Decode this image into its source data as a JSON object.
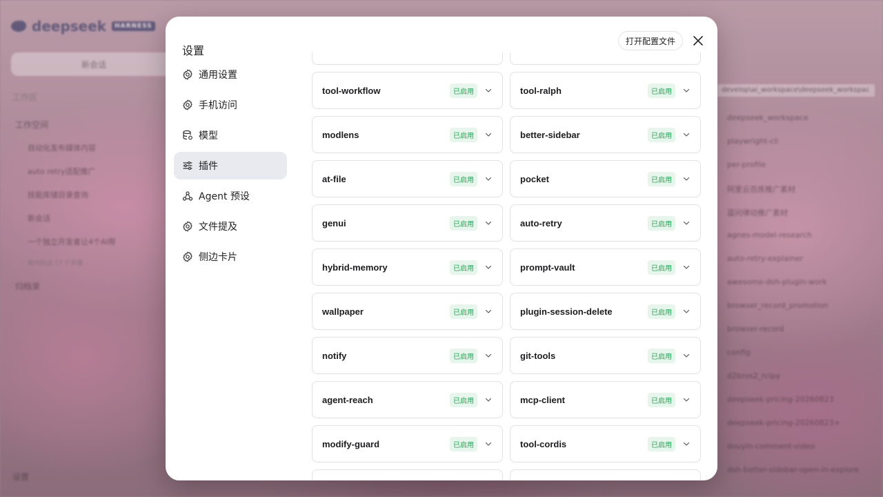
{
  "background_app": {
    "logo_text": "deepseek",
    "logo_badge": "HARNESS",
    "new_chat_label": "新会话",
    "section_label": "工作区",
    "workspace_label": "工作空间",
    "sessions": [
      "自动化发布媒体内容",
      "auto retry适配推广",
      "技能库储目录查询",
      "新会话",
      "一个独立开发者让4个AI帮"
    ],
    "session_meta": "帮代码战 17 个步骤",
    "archive_label": "归档录",
    "settings_label": "设置",
    "right_path": "develop\\ai_workspace\\deepseek_workspac",
    "right_workspace": "deepseek_workspace",
    "right_files": [
      "playwright-cli",
      "per-profile",
      "阿里云百炼推广素材",
      "蓝问律动推广素材",
      "agnes-model-research",
      "auto-retry-explainer",
      "awesome-dsh-plugin-work",
      "browser_record_promotion",
      "browser-record",
      "config",
      "d2bros2_rclpy",
      "deepseek-pricing-20260823",
      "deepseek-pricing-20260823+",
      "douyin-comment-video",
      "dsh-better-sidebar-open-in-explore"
    ]
  },
  "modal": {
    "title": "设置",
    "open_config_label": "打开配置文件",
    "nav": [
      {
        "label": "通用设置",
        "icon": "gear-icon",
        "active": false
      },
      {
        "label": "手机访问",
        "icon": "gear-icon",
        "active": false
      },
      {
        "label": "模型",
        "icon": "database-icon",
        "active": false
      },
      {
        "label": "插件",
        "icon": "sliders-icon",
        "active": true
      },
      {
        "label": "Agent 预设",
        "icon": "agent-icon",
        "active": false
      },
      {
        "label": "文件提及",
        "icon": "gear-icon",
        "active": false
      },
      {
        "label": "侧边卡片",
        "icon": "gear-icon",
        "active": false
      }
    ],
    "status_label": "已启用",
    "plugins": [
      [
        "",
        ""
      ],
      [
        "tool-workflow",
        "tool-ralph"
      ],
      [
        "modlens",
        "better-sidebar"
      ],
      [
        "at-file",
        "pocket"
      ],
      [
        "genui",
        "auto-retry"
      ],
      [
        "hybrid-memory",
        "prompt-vault"
      ],
      [
        "wallpaper",
        "plugin-session-delete"
      ],
      [
        "notify",
        "git-tools"
      ],
      [
        "agent-reach",
        "mcp-client"
      ],
      [
        "modify-guard",
        "tool-cordis"
      ],
      [
        "",
        ""
      ]
    ]
  },
  "colors": {
    "accent_status_text": "#27a554",
    "accent_status_bg": "#e7f6ec",
    "active_nav_bg": "#e8eaf0"
  }
}
